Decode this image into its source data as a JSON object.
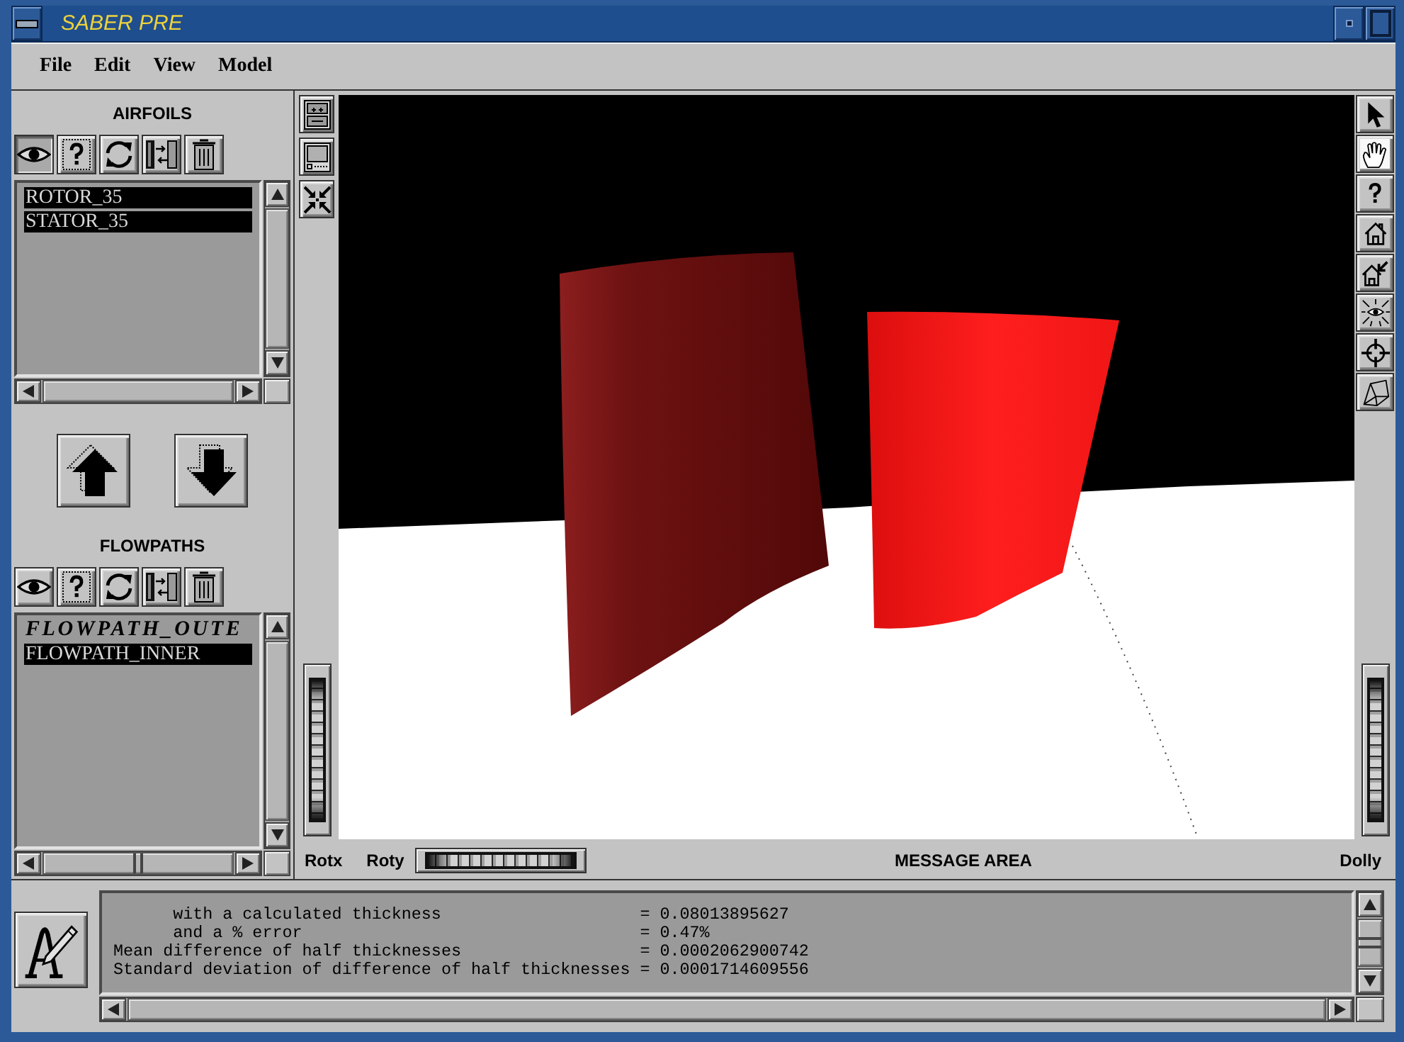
{
  "window": {
    "title": "SABER PRE"
  },
  "menu": [
    {
      "label": "File"
    },
    {
      "label": "Edit"
    },
    {
      "label": "View"
    },
    {
      "label": "Model"
    }
  ],
  "airfoils": {
    "title": "AIRFOILS",
    "tools": [
      {
        "kind": "eye",
        "pressed": true
      },
      {
        "kind": "help",
        "pressed": false
      },
      {
        "kind": "refresh",
        "pressed": false
      },
      {
        "kind": "transfer",
        "pressed": false
      },
      {
        "kind": "trash",
        "pressed": false
      }
    ],
    "items": [
      {
        "label": "ROTOR_35",
        "selected": true,
        "active": false
      },
      {
        "label": "STATOR_35",
        "selected": true,
        "active": false
      }
    ]
  },
  "move_buttons": [
    {
      "kind": "up"
    },
    {
      "kind": "down"
    }
  ],
  "flowpaths": {
    "title": "FLOWPATHS",
    "tools": [
      {
        "kind": "eye",
        "pressed": false
      },
      {
        "kind": "help",
        "pressed": false
      },
      {
        "kind": "refresh",
        "pressed": false
      },
      {
        "kind": "transfer",
        "pressed": false
      },
      {
        "kind": "trash",
        "pressed": false
      }
    ],
    "items": [
      {
        "label": "FLOWPATH_OUTE",
        "selected": false,
        "active": true
      },
      {
        "label": "FLOWPATH_INNER",
        "selected": true,
        "active": false
      }
    ]
  },
  "viewer": {
    "left_tools": [
      {
        "kind": "panel"
      },
      {
        "kind": "screen"
      },
      {
        "kind": "shrink"
      }
    ],
    "right_tools": [
      {
        "kind": "pointer",
        "selected": false
      },
      {
        "kind": "hand",
        "selected": true
      },
      {
        "kind": "help",
        "selected": false
      },
      {
        "kind": "home",
        "selected": false
      },
      {
        "kind": "set-home",
        "selected": false
      },
      {
        "kind": "view-all",
        "selected": false
      },
      {
        "kind": "seek",
        "selected": false
      },
      {
        "kind": "perspective",
        "selected": false
      }
    ],
    "x_wheel_label": "Rotx",
    "y_wheel_label": "Roty",
    "message_area_label": "MESSAGE AREA",
    "dolly_wheel_label": "Dolly"
  },
  "console": {
    "lines": [
      {
        "kind": "detail",
        "label": "with a calculated thickness",
        "value": "= 0.08013895627"
      },
      {
        "kind": "detail",
        "label": "and a % error",
        "value": "= 0.47%"
      },
      {
        "kind": "summary",
        "label": "Mean difference of half thicknesses",
        "value": "= 0.0002062900742"
      },
      {
        "kind": "summary",
        "label": "Standard deviation of difference of half thicknesses",
        "value": "= 0.0001714609556"
      }
    ]
  }
}
